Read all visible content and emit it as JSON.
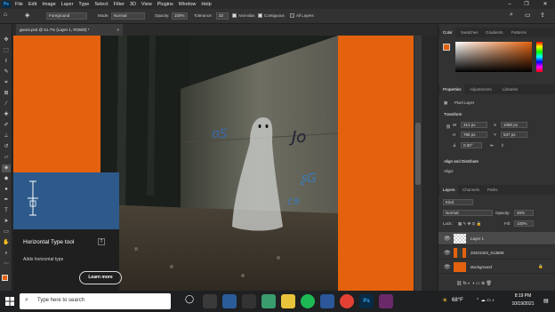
{
  "menu": {
    "logo": "Ps",
    "items": [
      "File",
      "Edit",
      "Image",
      "Layer",
      "Type",
      "Select",
      "Filter",
      "3D",
      "View",
      "Plugins",
      "Window",
      "Help"
    ]
  },
  "options": {
    "sample": "Foreground",
    "mode_label": "Mode:",
    "mode_value": "Normal",
    "opacity_label": "Opacity:",
    "opacity_value": "100%",
    "tolerance_label": "Tolerance:",
    "tolerance_value": "32",
    "antialias": "Anti-alias",
    "contiguous": "Contiguous",
    "all_layers": "All Layers"
  },
  "document": {
    "tab_title": "gwost.psd @ 51.7% (Layer 1, RGB/8) *",
    "tab_close": "×"
  },
  "tooltip": {
    "title": "Horizontal Type tool",
    "shortcut": "T",
    "description": "Adds horizontal type",
    "button": "Learn more"
  },
  "color_panel": {
    "tabs": [
      "Color",
      "Swatches",
      "Gradients",
      "Patterns"
    ]
  },
  "properties_panel": {
    "tabs": [
      "Properties",
      "Adjustments",
      "Libraries"
    ],
    "layer_type": "Pixel Layer",
    "transform_heading": "Transform",
    "w_label": "W",
    "w_value": "312 px",
    "h_label": "H",
    "h_value": "786 px",
    "x_label": "X",
    "x_value": "1080 px",
    "y_label": "Y",
    "y_value": "537 px",
    "angle_value": "0.00°",
    "align_heading": "Align and Distribute",
    "align_label": "Align:"
  },
  "layers_panel": {
    "tabs": [
      "Layers",
      "Channels",
      "Paths"
    ],
    "kind": "Kind",
    "blend": "Normal",
    "opacity_label": "Opacity:",
    "opacity_value": "45%",
    "lock_label": "Lock:",
    "fill_label": "Fill:",
    "fill_value": "100%",
    "layers": [
      {
        "name": "Layer 1",
        "selected": true
      },
      {
        "name": "20201003_013808",
        "selected": false
      },
      {
        "name": "Background",
        "selected": false
      }
    ]
  },
  "taskbar": {
    "search_placeholder": "Type here to search",
    "weather": "68°F",
    "time": "8:19 PM",
    "date": "10/19/2021"
  },
  "colors": {
    "accent_orange": "#e4620e",
    "tooltip_blue": "#2d5a8a",
    "foreground_swatch": "#e4620e"
  }
}
